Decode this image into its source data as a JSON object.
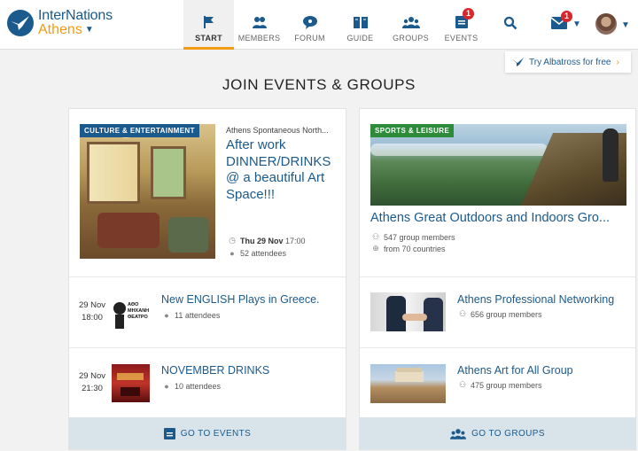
{
  "brand": {
    "name": "InterNations",
    "city": "Athens"
  },
  "nav": [
    {
      "label": "START",
      "icon": "flag-icon",
      "active": true
    },
    {
      "label": "MEMBERS",
      "icon": "members-icon"
    },
    {
      "label": "FORUM",
      "icon": "forum-icon"
    },
    {
      "label": "GUIDE",
      "icon": "guide-icon"
    },
    {
      "label": "GROUPS",
      "icon": "groups-icon"
    },
    {
      "label": "EVENTS",
      "icon": "events-icon",
      "badge": "1"
    }
  ],
  "header": {
    "mail_badge": "1"
  },
  "albatross": {
    "label": "Try Albatross for free"
  },
  "page_title": "JOIN EVENTS & GROUPS",
  "events": {
    "featured": {
      "tag": "CULTURE & ENTERTAINMENT",
      "group": "Athens Spontaneous North...",
      "title": "After work DINNER/DRINKS @ a beautiful Art Space!!!",
      "date": "Thu 29 Nov",
      "time": "17:00",
      "attendees": "52 attendees"
    },
    "items": [
      {
        "day": "29 Nov",
        "time": "18:00",
        "title": "New ENGLISH Plays in Greece.",
        "attendees": "11 attendees",
        "thumb_text": "ΑΘΟ ΜΗΧΑΝΗ ΘΕΑΤΡΟ"
      },
      {
        "day": "29 Nov",
        "time": "21:30",
        "title": "NOVEMBER DRINKS",
        "attendees": "10 attendees"
      }
    ],
    "cta": "GO TO EVENTS"
  },
  "groups": {
    "featured": {
      "tag": "SPORTS & LEISURE",
      "title": "Athens Great Outdoors and Indoors Gro...",
      "members": "547 group members",
      "countries": "from 70 countries"
    },
    "items": [
      {
        "title": "Athens Professional Networking",
        "members": "656 group members"
      },
      {
        "title": "Athens Art for All Group",
        "members": "475 group members"
      }
    ],
    "cta": "GO TO GROUPS"
  },
  "colors": {
    "brand_blue": "#1b5a8c",
    "accent_orange": "#f39c12",
    "badge_red": "#d9262b",
    "culture_tag": "#1b5a8c",
    "sports_tag": "#2e8b3a"
  }
}
